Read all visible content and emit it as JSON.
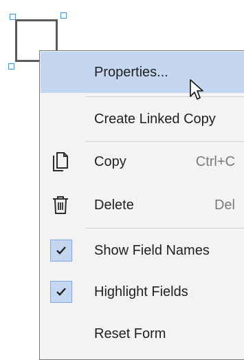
{
  "menu": {
    "properties": "Properties...",
    "create_linked_copy": "Create Linked Copy",
    "copy": "Copy",
    "copy_shortcut": "Ctrl+C",
    "delete": "Delete",
    "delete_shortcut": "Del",
    "show_field_names": "Show Field Names",
    "highlight_fields": "Highlight Fields",
    "reset_form": "Reset Form"
  },
  "state": {
    "show_field_names_checked": true,
    "highlight_fields_checked": true,
    "hovered_item": "properties"
  },
  "colors": {
    "hover": "#c5d7f0",
    "handle": "#3a8fe0",
    "menu_bg": "#f3f3f3"
  }
}
